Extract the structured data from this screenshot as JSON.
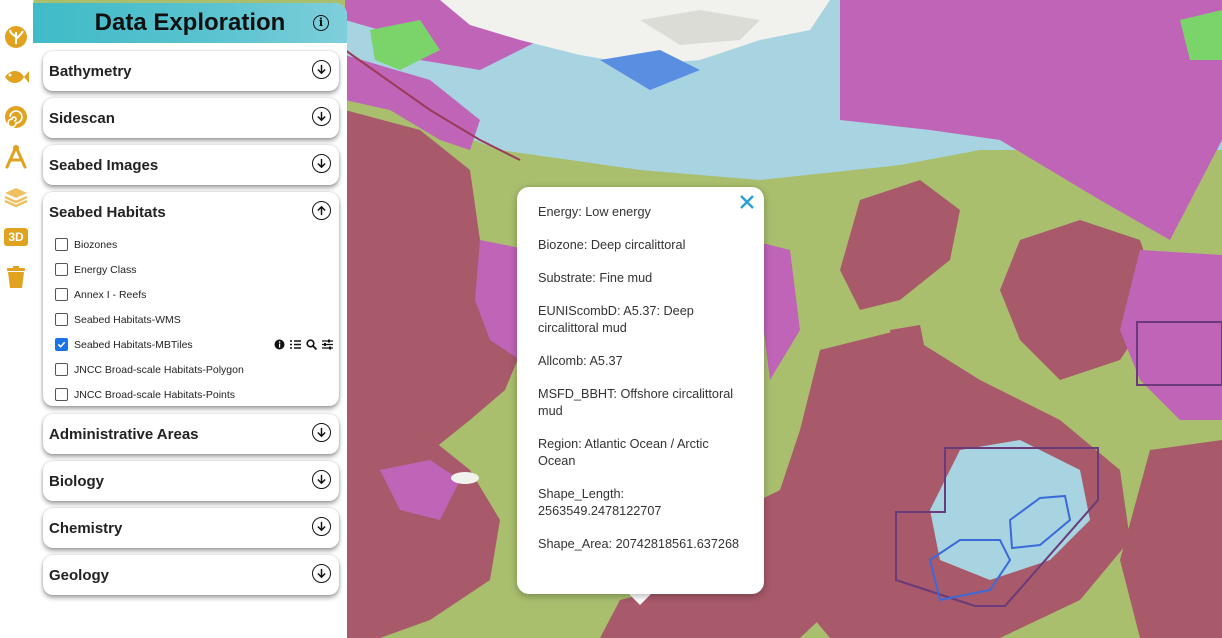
{
  "panel": {
    "title": "Data Exploration",
    "info_icon": "info-icon",
    "sections": [
      {
        "label": "Bathymetry",
        "state": "collapsed"
      },
      {
        "label": "Sidescan",
        "state": "collapsed"
      },
      {
        "label": "Seabed Images",
        "state": "collapsed"
      },
      {
        "label": "Seabed Habitats",
        "state": "expanded"
      },
      {
        "label": "Administrative Areas",
        "state": "collapsed"
      },
      {
        "label": "Biology",
        "state": "collapsed"
      },
      {
        "label": "Chemistry",
        "state": "collapsed"
      },
      {
        "label": "Geology",
        "state": "collapsed"
      }
    ],
    "habitat_layers": [
      {
        "label": "Biozones",
        "checked": false
      },
      {
        "label": "Energy Class",
        "checked": false
      },
      {
        "label": "Annex I - Reefs",
        "checked": false
      },
      {
        "label": "Seabed Habitats-WMS",
        "checked": false
      },
      {
        "label": "Seabed Habitats-MBTiles",
        "checked": true
      },
      {
        "label": "JNCC Broad-scale Habitats-Polygon",
        "checked": false
      },
      {
        "label": "JNCC Broad-scale Habitats-Points",
        "checked": false
      }
    ],
    "layer_tools": [
      "info-icon",
      "legend-list-icon",
      "zoom-search-icon",
      "settings-sliders-icon"
    ]
  },
  "rail": {
    "icons": [
      "coral-icon",
      "fish-icon",
      "shell-icon",
      "measure-icon",
      "layers-icon",
      "3d-icon",
      "trash-icon"
    ],
    "label_3d": "3D",
    "accent": "#e0a21f"
  },
  "popup": {
    "lines": [
      "Energy: Low energy",
      "Biozone: Deep circalittoral",
      "Substrate: Fine mud",
      "EUNIScombD: A5.37: Deep circalittoral mud",
      "Allcomb: A5.37",
      "MSFD_BBHT: Offshore circalittoral mud",
      "Region: Atlantic Ocean / Arctic Ocean",
      "Shape_Length: 2563549.2478122707",
      "Shape_Area: 20742818561.637268"
    ],
    "close_icon": "close-icon",
    "close_color": "#2a9fd6"
  },
  "map_colors": {
    "mud_green": "#a9bf6e",
    "deep_red": "#a85a6a",
    "magenta": "#c064b8",
    "light_blue": "#a8d4e2",
    "white_ice": "#f1f1ee"
  }
}
